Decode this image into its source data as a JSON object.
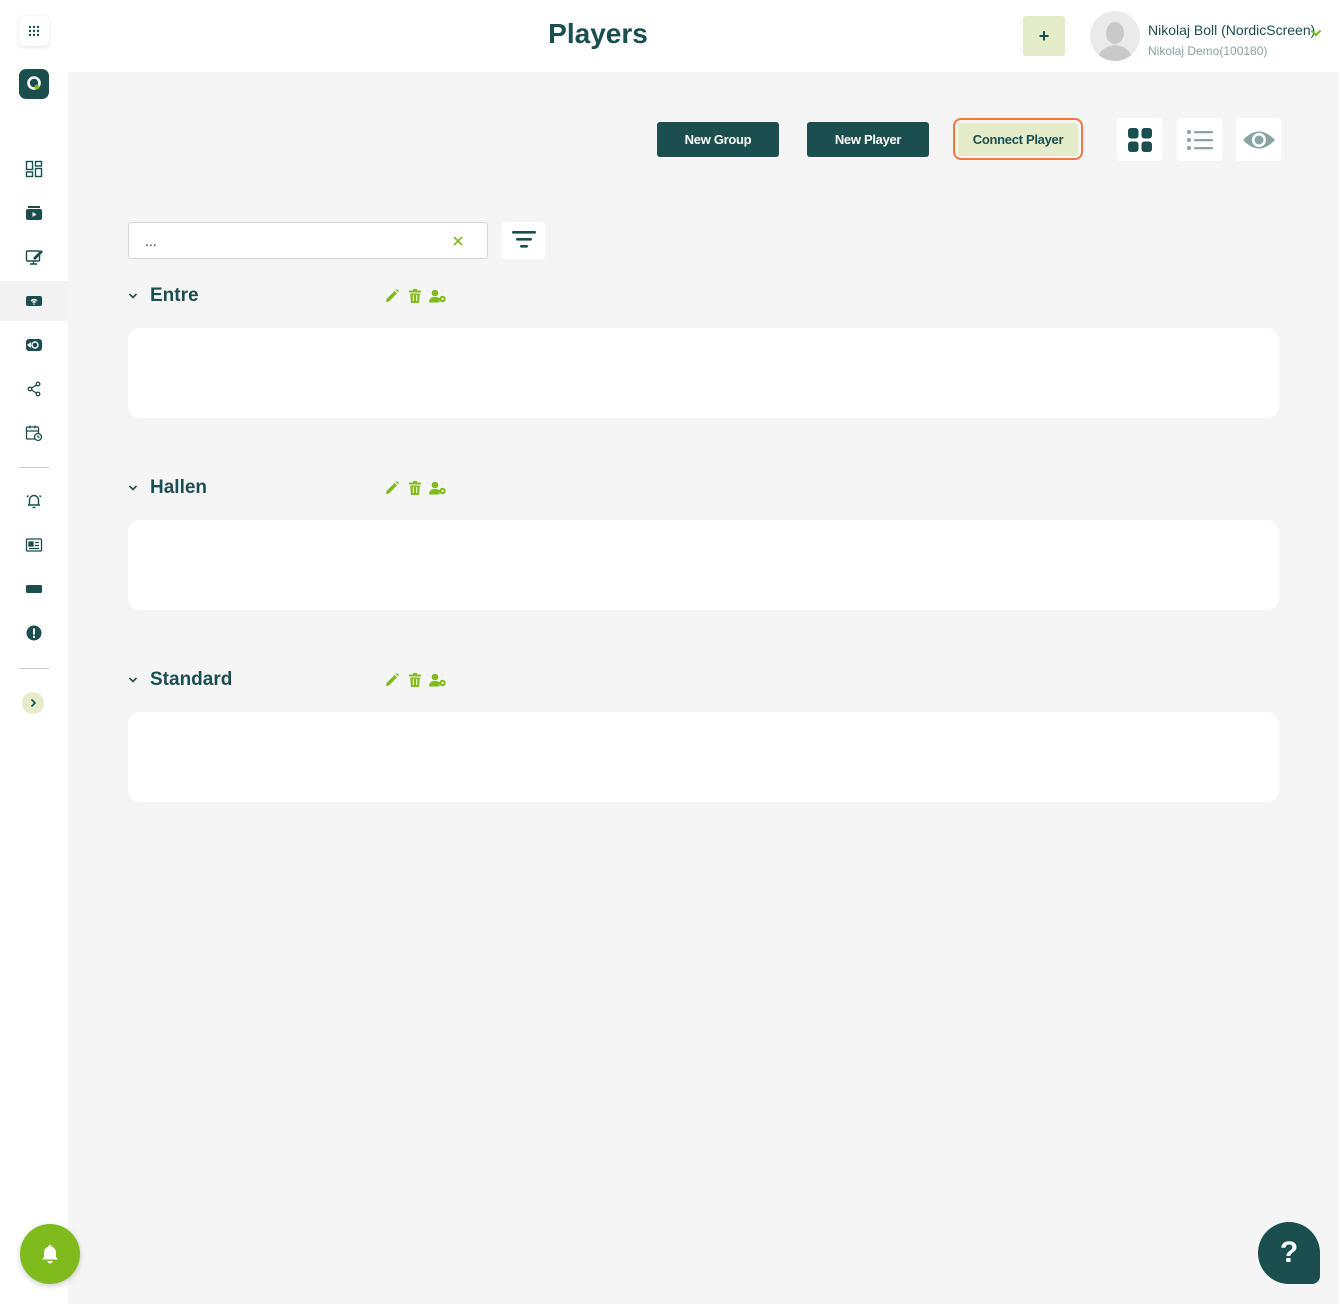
{
  "header": {
    "title": "Players",
    "add_label": "+",
    "user_name": "Nikolaj Boll (NordicScreen)",
    "user_account": "Nikolaj Demo(100180)"
  },
  "toolbar": {
    "new_group": "New Group",
    "new_player": "New Player",
    "connect_player": "Connect Player"
  },
  "search": {
    "value": "...",
    "placeholder": ""
  },
  "groups": [
    {
      "name": "Entre"
    },
    {
      "name": "Hallen"
    },
    {
      "name": "Standard"
    }
  ],
  "help": {
    "label": "?"
  },
  "colors": {
    "primary": "#1a4e4f",
    "accent": "#7fbb1c",
    "accent_light": "#e4ecc9",
    "highlight": "#f2773c"
  },
  "icons": {
    "sidebar": [
      "apps-grid-icon",
      "logo-icon",
      "dashboard-icon",
      "media-icon",
      "playlist-edit-icon",
      "players-icon",
      "channels-icon",
      "share-icon",
      "schedule-icon",
      "alerts-icon",
      "news-icon",
      "ticker-icon",
      "warning-icon",
      "expand-icon"
    ],
    "group_actions": [
      "edit-icon",
      "delete-icon",
      "assign-user-icon"
    ]
  }
}
